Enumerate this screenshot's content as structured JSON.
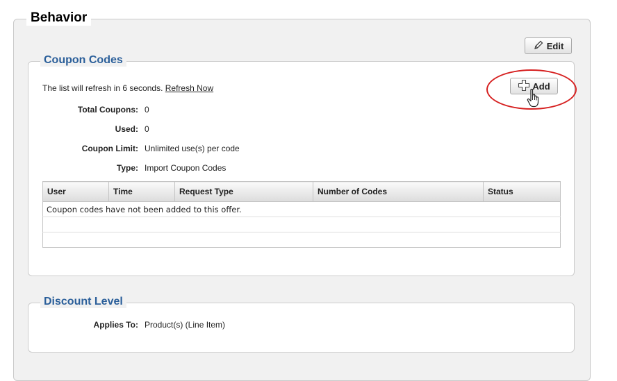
{
  "behavior": {
    "title": "Behavior",
    "edit_label": "Edit"
  },
  "coupon_codes": {
    "title": "Coupon Codes",
    "refresh_text": "The list will refresh in 6 seconds.",
    "refresh_link": "Refresh Now",
    "add_label": "Add",
    "fields": [
      {
        "label": "Total Coupons:",
        "value": "0"
      },
      {
        "label": "Used:",
        "value": "0"
      },
      {
        "label": "Coupon Limit:",
        "value": "Unlimited use(s) per code"
      },
      {
        "label": "Type:",
        "value": "Import Coupon Codes"
      }
    ],
    "table": {
      "columns": [
        "User",
        "Time",
        "Request Type",
        "Number of Codes",
        "Status"
      ],
      "empty_message": "Coupon codes have not been added to this offer."
    }
  },
  "discount_level": {
    "title": "Discount Level",
    "applies_label": "Applies To:",
    "applies_value": "Product(s) (Line Item)"
  },
  "icons": {
    "edit": "pencil-icon",
    "add": "plus-icon",
    "cursor": "hand-pointer-icon"
  },
  "colors": {
    "section_title": "#2b5f9a",
    "highlight": "#d62020"
  }
}
